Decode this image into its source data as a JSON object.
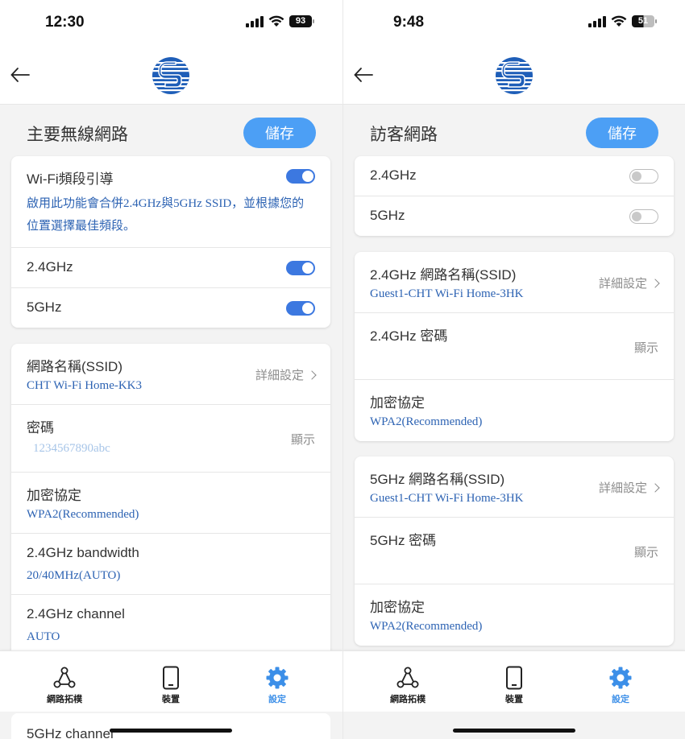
{
  "left": {
    "status": {
      "time": "12:30",
      "battery": "93"
    },
    "page_title": "主要無線網路",
    "save_label": "儲存",
    "band_card": {
      "steering_label": "Wi-Fi頻段引導",
      "steering_desc": "啟用此功能會合併2.4GHz與5GHz SSID，並根據您的位置選擇最佳頻段。",
      "band_24_label": "2.4GHz",
      "band_5_label": "5GHz",
      "steering_on": true,
      "band_24_on": true,
      "band_5_on": true
    },
    "network_card": {
      "ssid_label": "網路名稱(SSID)",
      "ssid_value": "CHT Wi-Fi Home-KK3",
      "ssid_detail": "詳細設定",
      "password_label": "密碼",
      "password_value": "1234567890abc",
      "password_show": "顯示",
      "encryption_label": "加密協定",
      "encryption_value": "WPA2(Recommended)",
      "bw24_label": "2.4GHz bandwidth",
      "bw24_value": "20/40MHz(AUTO)",
      "ch24_label": "2.4GHz channel",
      "ch24_value": "AUTO",
      "ch5_label": "5GHz channel"
    }
  },
  "right": {
    "status": {
      "time": "9:48",
      "battery": "51"
    },
    "page_title": "訪客網路",
    "save_label": "儲存",
    "band_card": {
      "band_24_label": "2.4GHz",
      "band_5_label": "5GHz",
      "band_24_on": false,
      "band_5_on": false
    },
    "guest_24_card": {
      "ssid_label": "2.4GHz 網路名稱(SSID)",
      "ssid_value": "Guest1-CHT Wi-Fi Home-3HK",
      "ssid_detail": "詳細設定",
      "password_label": "2.4GHz 密碼",
      "password_show": "顯示",
      "encryption_label": "加密協定",
      "encryption_value": "WPA2(Recommended)"
    },
    "guest_5_card": {
      "ssid_label": "5GHz 網路名稱(SSID)",
      "ssid_value": "Guest1-CHT Wi-Fi Home-3HK",
      "ssid_detail": "詳細設定",
      "password_label": "5GHz 密碼",
      "password_show": "顯示",
      "encryption_label": "加密協定",
      "encryption_value": "WPA2(Recommended)"
    }
  },
  "nav": {
    "topology": "網路拓樸",
    "devices": "裝置",
    "settings": "設定",
    "active": "settings"
  },
  "colors": {
    "accent": "#4c9ff5",
    "toggle_on": "#3c78e0",
    "value_text": "#2d63b3",
    "logo_blue": "#1e5eb8"
  },
  "icons": {
    "back": "arrow-left-icon",
    "logo": "cht-logo-icon",
    "chevron": "chevron-right-icon",
    "topology": "network-topology-icon",
    "devices": "smartphone-icon",
    "settings": "gear-icon"
  }
}
